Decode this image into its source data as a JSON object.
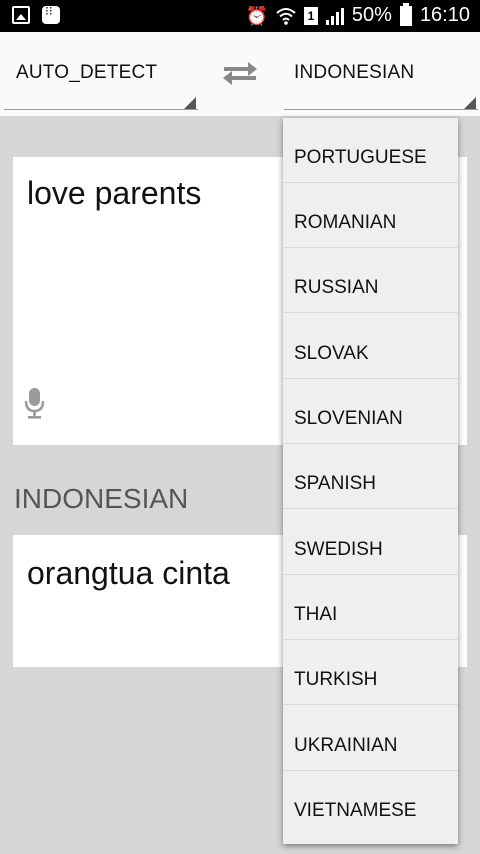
{
  "status_bar": {
    "left_icons": [
      "gallery-icon",
      "bbm-icon"
    ],
    "right_icons": [
      "alarm-icon",
      "wifi-icon",
      "sim-icon",
      "signal-icon",
      "battery-icon"
    ],
    "sim_label": "1",
    "battery_percent": "50%",
    "time": "16:10"
  },
  "toolbar": {
    "source_language": "AUTO_DETECT",
    "target_language": "INDONESIAN",
    "swap_icon": "swap-arrows-icon"
  },
  "input": {
    "text": "love parents",
    "mic_icon": "microphone-icon"
  },
  "output": {
    "language_label": "INDONESIAN",
    "text": "orangtua cinta"
  },
  "dropdown": {
    "items": [
      "PORTUGUESE",
      "ROMANIAN",
      "RUSSIAN",
      "SLOVAK",
      "SLOVENIAN",
      "SPANISH",
      "SWEDISH",
      "THAI",
      "TURKISH",
      "UKRAINIAN",
      "VIETNAMESE"
    ]
  },
  "colors": {
    "background": "#d6d6d6",
    "toolbar": "#fafafa",
    "dropdown": "#efefef",
    "status_bar": "#000000"
  }
}
